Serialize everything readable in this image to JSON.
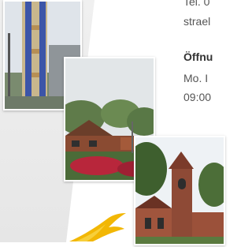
{
  "contact": {
    "tel_line": "Tel. 0",
    "email_line": "strael",
    "opening_heading": "Öffnu",
    "opening_days": "Mo. I",
    "opening_time": "09:00"
  }
}
